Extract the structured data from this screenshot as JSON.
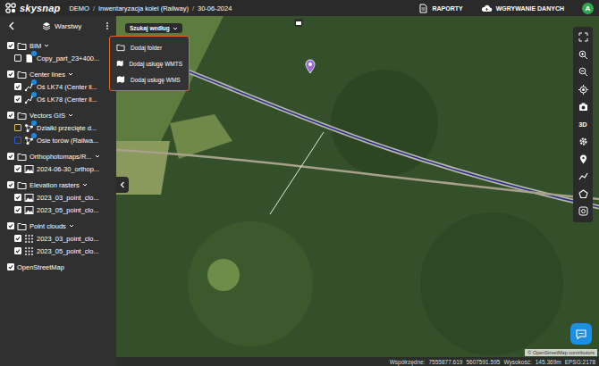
{
  "topbar": {
    "logo": "skysnap",
    "breadcrumb": [
      "DEMO",
      "Inwentaryzacja kolei (Railway)",
      "30-06-2024"
    ],
    "separator": "/",
    "actions": [
      {
        "label": "RAPORTY",
        "kind": "report"
      },
      {
        "label": "WGRYWANIE DANYCH",
        "kind": "upload"
      }
    ],
    "avatar": "A"
  },
  "sidebar": {
    "title": "Warstwy",
    "groups": [
      {
        "name": "BIM",
        "kind": "folder",
        "checked": true,
        "expanded": true,
        "items": [
          {
            "name": "Copy_part_23+400...",
            "kind": "model",
            "checked": false
          }
        ]
      },
      {
        "name": "Center lines",
        "kind": "folder",
        "checked": true,
        "expanded": true,
        "items": [
          {
            "name": "Oś LK74 (Center li...",
            "kind": "line",
            "checked": true
          },
          {
            "name": "Oś LK78 (Center li...",
            "kind": "line",
            "checked": true
          }
        ]
      },
      {
        "name": "Vectors GIS",
        "kind": "folder",
        "checked": true,
        "expanded": true,
        "items": [
          {
            "name": "Działki przecięte d...",
            "kind": "vector",
            "checked": false,
            "color": "#d8c24a"
          },
          {
            "name": "Osie torów (Railwa...",
            "kind": "vector",
            "checked": false,
            "color": "#2f5bd8"
          }
        ]
      },
      {
        "name": "Orthophotomaps/R...",
        "kind": "folder",
        "checked": true,
        "expanded": true,
        "items": [
          {
            "name": "2024-06-30_orthop...",
            "kind": "raster",
            "checked": true
          }
        ]
      },
      {
        "name": "Elevation rasters",
        "kind": "folder",
        "checked": true,
        "expanded": true,
        "items": [
          {
            "name": "2023_03_point_clo...",
            "kind": "raster",
            "checked": true
          },
          {
            "name": "2023_05_point_clo...",
            "kind": "raster",
            "checked": true
          }
        ]
      },
      {
        "name": "Point clouds",
        "kind": "folder",
        "checked": true,
        "expanded": true,
        "items": [
          {
            "name": "2023_03_point_clo...",
            "kind": "cloud",
            "checked": true
          },
          {
            "name": "2023_05_point_clo...",
            "kind": "cloud",
            "checked": true
          }
        ]
      },
      {
        "name": "OpenStreetMap",
        "kind": "basemap",
        "checked": true,
        "expanded": false,
        "items": []
      }
    ]
  },
  "map": {
    "search_button": "Szukaj według",
    "menu": [
      {
        "label": "Dodaj folder",
        "kind": "folder"
      },
      {
        "label": "Dodaj usługę WMTS",
        "kind": "service"
      },
      {
        "label": "Dodaj usługę WMS",
        "kind": "service"
      }
    ],
    "attribution": "© OpenStreetMap contributors"
  },
  "toolbar": [
    {
      "kind": "fullscreen"
    },
    {
      "kind": "zoomin"
    },
    {
      "kind": "zoomout"
    },
    {
      "kind": "locate"
    },
    {
      "kind": "camera"
    },
    {
      "kind": "text",
      "label": "3D"
    },
    {
      "kind": "settings"
    },
    {
      "kind": "marker"
    },
    {
      "kind": "measure"
    },
    {
      "kind": "polygon"
    },
    {
      "kind": "target"
    }
  ],
  "status": {
    "coords_label": "Współrzędne:",
    "x": "7555877.619",
    "y": "5607591.595",
    "height_label": "Wysokość:",
    "height": "145.369m",
    "epsg": "EPSG:2178"
  }
}
